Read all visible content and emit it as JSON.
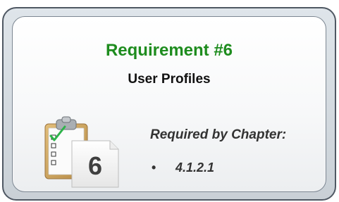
{
  "requirement": {
    "title": "Requirement #6",
    "subtitle": "User Profiles",
    "required_by_label": "Required by Chapter:",
    "bullet_symbol": "•",
    "chapters": [
      "4.1.2.1"
    ],
    "number_badge": "6"
  },
  "colors": {
    "title_green": "#1e8c1e",
    "frame_border": "#4f5863",
    "clipboard_brown": "#c9a15e",
    "check_green": "#2eb34a"
  },
  "icons": {
    "clipboard": "clipboard-checklist-icon"
  }
}
